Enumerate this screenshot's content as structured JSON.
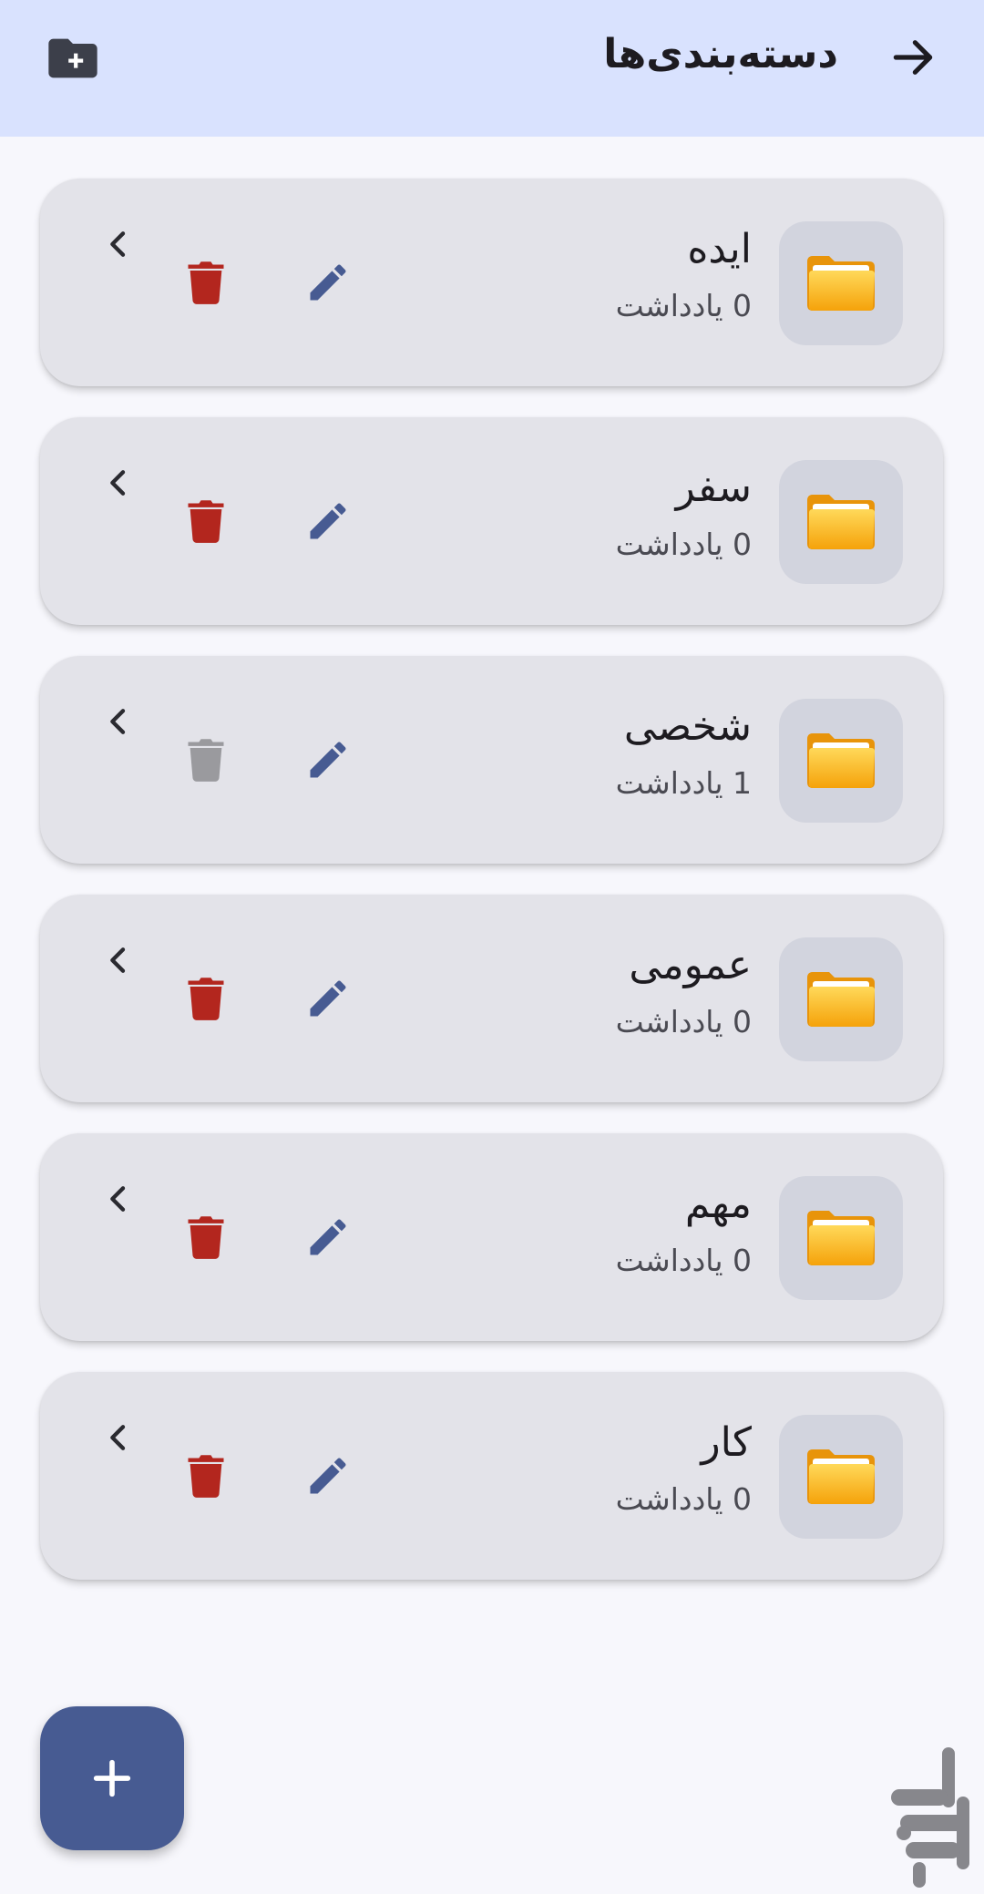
{
  "header": {
    "title": "دسته‌بندی‌ها",
    "back_icon": "arrow-right-icon",
    "add_folder_icon": "create-new-folder-icon"
  },
  "categories": [
    {
      "name": "ایده",
      "count": "0 یادداشت",
      "delete_enabled": true
    },
    {
      "name": "سفر",
      "count": "0 یادداشت",
      "delete_enabled": true
    },
    {
      "name": "شخصی",
      "count": "1 یادداشت",
      "delete_enabled": false
    },
    {
      "name": "عمومی",
      "count": "0 یادداشت",
      "delete_enabled": true
    },
    {
      "name": "مهم",
      "count": "0 یادداشت",
      "delete_enabled": true
    },
    {
      "name": "کار",
      "count": "0 یادداشت",
      "delete_enabled": true
    }
  ],
  "colors": {
    "appbar": "#d9e2fe",
    "card": "#e3e3e9",
    "edit": "#475b92",
    "delete": "#b3261e",
    "delete_disabled": "#9a9a9e",
    "fab": "#475b92"
  },
  "fab": {
    "icon": "plus-icon"
  }
}
